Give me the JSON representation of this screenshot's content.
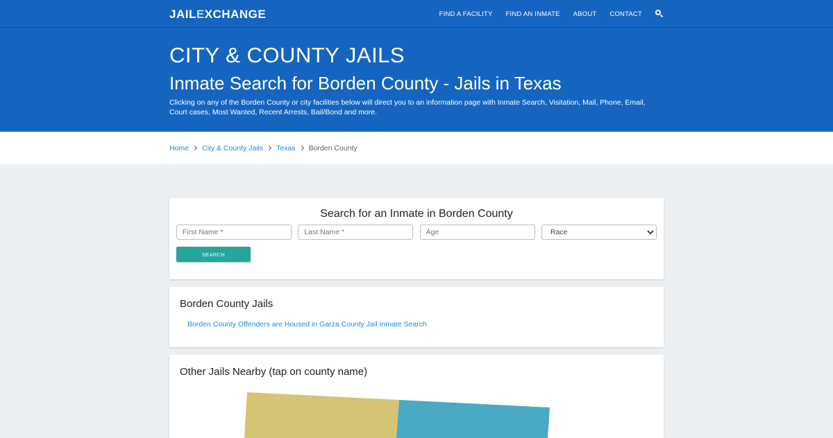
{
  "nav": {
    "logo_prefix": "JAIL",
    "logo_x": "E",
    "logo_suffix": "XCHANGE",
    "links": [
      "FIND A FACILITY",
      "FIND AN INMATE",
      "ABOUT",
      "CONTACT"
    ],
    "search_icon": "search-icon"
  },
  "hero": {
    "title": "CITY & COUNTY JAILS",
    "subtitle": "Inmate Search for Borden County - Jails in Texas",
    "description": "Clicking on any of the Borden County or city facilities below will direct you to an information page with Inmate Search, Visitation, Mail, Phone, Email, Court cases, Most Wanted, Recent Arrests, Bail/Bond and more."
  },
  "breadcrumb": {
    "items": [
      "Home",
      "City & County Jails",
      "Texas"
    ],
    "current": "Borden County"
  },
  "search_form": {
    "title": "Search for an Inmate in Borden County",
    "first_name_placeholder": "First Name *",
    "last_name_placeholder": "Last Name *",
    "age_placeholder": "Age",
    "race_selected": "Race",
    "button_label": "SEARCH"
  },
  "jails": {
    "heading": "Borden County Jails",
    "link": "Borden County Offenders are Housed in Garza County Jail Inmate Search"
  },
  "nearby": {
    "heading": "Other Jails Nearby (tap on county name)"
  },
  "colors": {
    "primary": "#1565c0",
    "accent_button": "#26a69a",
    "link": "#1e88e5",
    "map_county_a": "#d4c474",
    "map_county_b": "#4aaac4"
  }
}
